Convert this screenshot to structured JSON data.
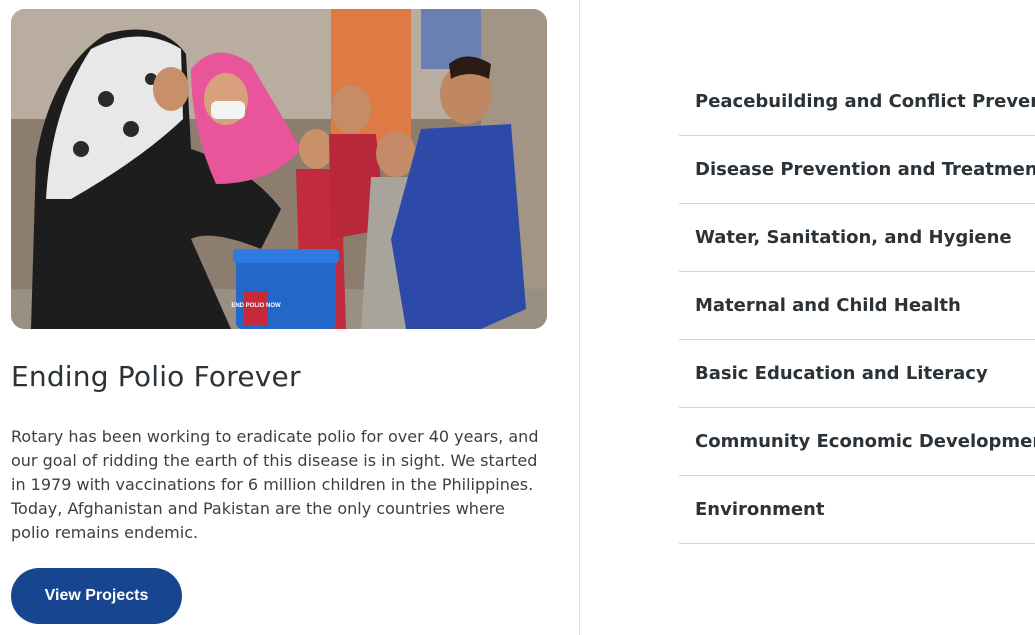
{
  "feature": {
    "title": "Ending Polio Forever",
    "body": "Rotary has been working to eradicate polio for over 40 years, and our goal of ridding the earth of this disease is in sight. We started in 1979 with vaccinations for 6 million children in the Philippines. Today, Afghanistan and Pakistan are the only countries where polio remains endemic.",
    "button_label": "View Projects",
    "photo_cooler_text": "END POLIO NOW"
  },
  "topics": [
    {
      "label": "Peacebuilding and Conflict Prevention"
    },
    {
      "label": "Disease Prevention and Treatment"
    },
    {
      "label": "Water, Sanitation, and Hygiene"
    },
    {
      "label": "Maternal and Child Health"
    },
    {
      "label": "Basic Education and Literacy"
    },
    {
      "label": "Community Economic Development"
    },
    {
      "label": "Environment"
    }
  ],
  "colors": {
    "button": "#17458f",
    "text": "#2c3338",
    "divider": "#d4d4d4"
  }
}
